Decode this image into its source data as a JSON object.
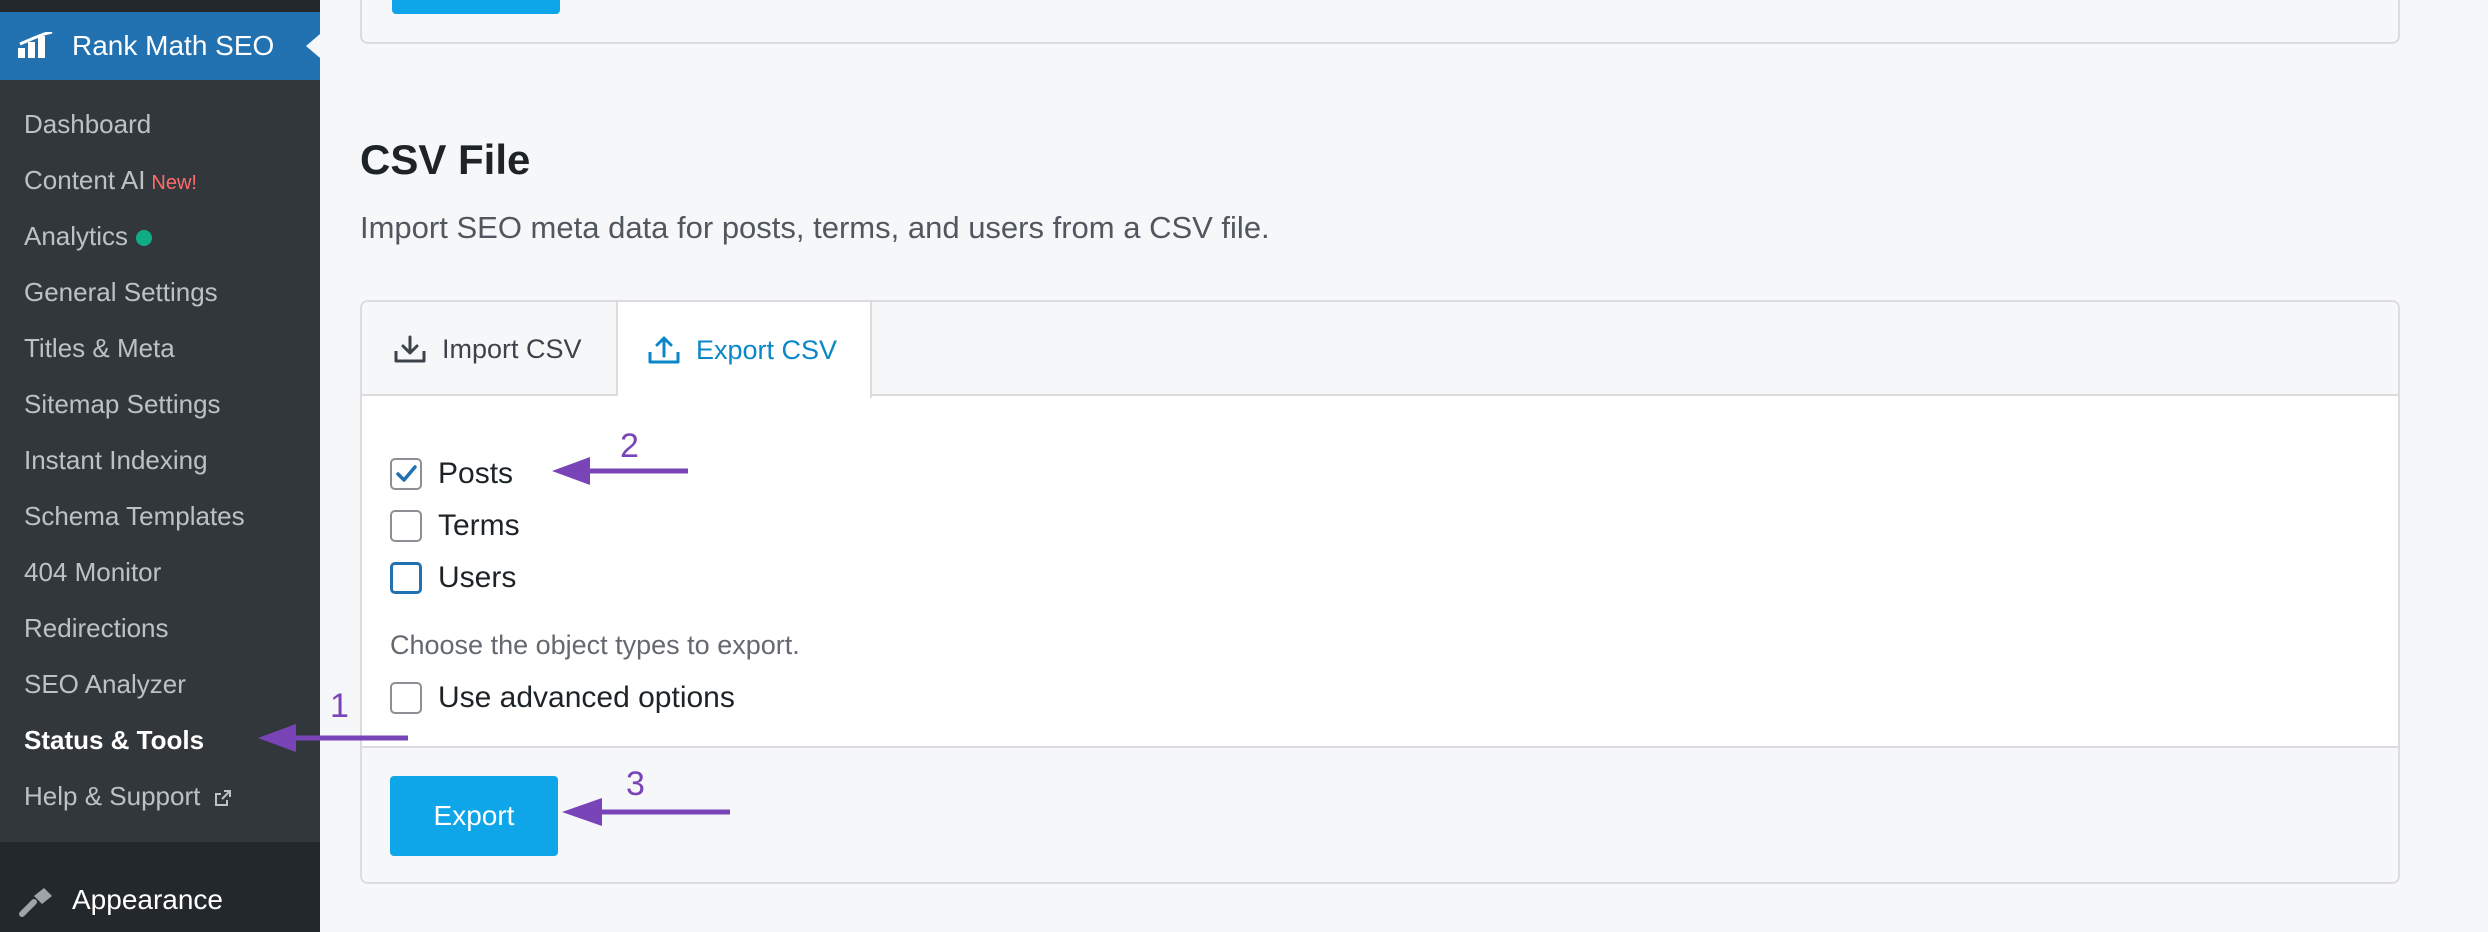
{
  "sidebar": {
    "plugin_title": "Rank Math SEO",
    "items": [
      {
        "label": "Dashboard"
      },
      {
        "label": "Content AI",
        "badge": "New!"
      },
      {
        "label": "Analytics",
        "status_color": "#10ac84"
      },
      {
        "label": "General Settings"
      },
      {
        "label": "Titles & Meta"
      },
      {
        "label": "Sitemap Settings"
      },
      {
        "label": "Instant Indexing"
      },
      {
        "label": "Schema Templates"
      },
      {
        "label": "404 Monitor"
      },
      {
        "label": "Redirections"
      },
      {
        "label": "SEO Analyzer"
      },
      {
        "label": "Status & Tools",
        "current": true
      },
      {
        "label": "Help & Support",
        "icon": "external-link-icon"
      }
    ],
    "appearance_label": "Appearance"
  },
  "main": {
    "section_title": "CSV File",
    "section_description": "Import SEO meta data for posts, terms, and users from a CSV file.",
    "tabs": [
      {
        "label": "Import CSV",
        "icon": "download-icon",
        "active": false
      },
      {
        "label": "Export CSV",
        "icon": "upload-icon",
        "active": true
      }
    ],
    "options": [
      {
        "label": "Posts",
        "checked": true
      },
      {
        "label": "Terms",
        "checked": false
      },
      {
        "label": "Users",
        "checked": false,
        "focused": true
      }
    ],
    "help_text": "Choose the object types to export.",
    "advanced_option": {
      "label": "Use advanced options",
      "checked": false
    },
    "export_button": "Export"
  },
  "annotations": {
    "labels": [
      "1",
      "2",
      "3"
    ],
    "color": "#7a44b9"
  },
  "colors": {
    "accent": "#0ea5e9",
    "active_tab": "#0b87c9",
    "sidebar_bg": "#23282d",
    "submenu_bg": "#32373c",
    "plugin_header_bg": "#2271b1"
  }
}
